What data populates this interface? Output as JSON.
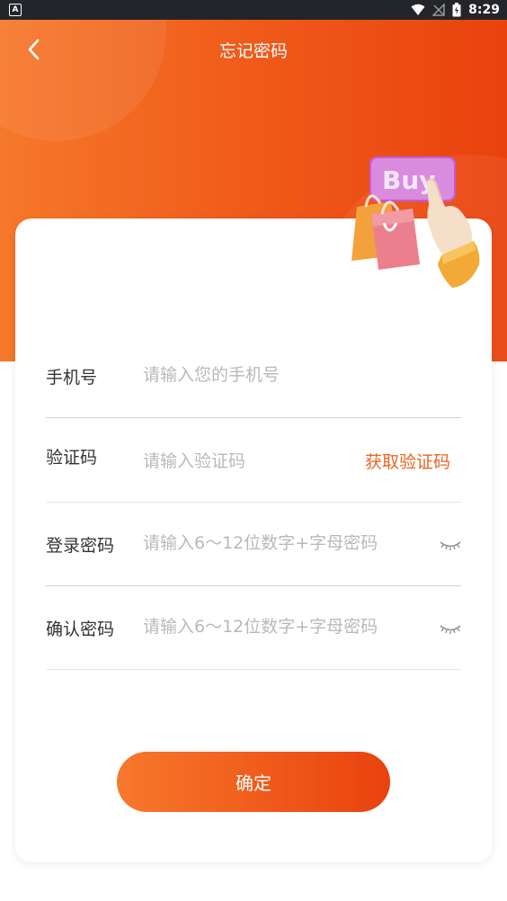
{
  "status_bar": {
    "left_badge": "A",
    "time": "8:29"
  },
  "header": {
    "title": "忘记密码"
  },
  "illustration": {
    "text": "Buy"
  },
  "form": {
    "phone": {
      "label": "手机号",
      "placeholder": "请输入您的手机号",
      "value": ""
    },
    "code": {
      "label": "验证码",
      "placeholder": "请输入验证码",
      "value": "",
      "get_code_label": "获取验证码"
    },
    "password": {
      "label": "登录密码",
      "placeholder": "请输入6～12位数字+字母密码",
      "value": ""
    },
    "confirm_password": {
      "label": "确认密码",
      "placeholder": "请输入6～12位数字+字母密码",
      "value": ""
    }
  },
  "actions": {
    "confirm_label": "确定"
  },
  "colors": {
    "accent": "#ec6420",
    "gradient_start": "#f7782c",
    "gradient_end": "#e9420d"
  }
}
